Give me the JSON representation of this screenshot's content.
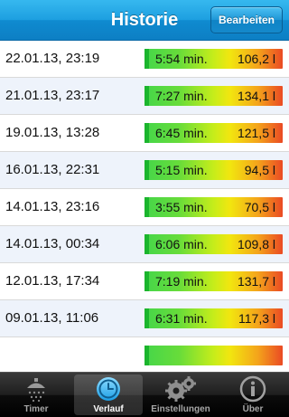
{
  "header": {
    "title": "Historie",
    "edit_label": "Bearbeiten"
  },
  "rows": [
    {
      "date": "22.01.13, 23:19",
      "duration": "5:54 min.",
      "volume": "106,2 l"
    },
    {
      "date": "21.01.13, 23:17",
      "duration": "7:27 min.",
      "volume": "134,1 l"
    },
    {
      "date": "19.01.13, 13:28",
      "duration": "6:45 min.",
      "volume": "121,5 l"
    },
    {
      "date": "16.01.13, 22:31",
      "duration": "5:15 min.",
      "volume": "94,5 l"
    },
    {
      "date": "14.01.13, 23:16",
      "duration": "3:55 min.",
      "volume": "70,5 l"
    },
    {
      "date": "14.01.13, 00:34",
      "duration": "6:06 min.",
      "volume": "109,8 l"
    },
    {
      "date": "12.01.13, 17:34",
      "duration": "7:19 min.",
      "volume": "131,7 l"
    },
    {
      "date": "09.01.13, 11:06",
      "duration": "6:31 min.",
      "volume": "117,3 l"
    },
    {
      "date": "",
      "duration": "",
      "volume": ""
    }
  ],
  "tabs": [
    {
      "label": "Timer",
      "icon": "shower-icon"
    },
    {
      "label": "Verlauf",
      "icon": "clock-icon",
      "active": true
    },
    {
      "label": "Einstellungen",
      "icon": "gears-icon"
    },
    {
      "label": "Über",
      "icon": "info-icon"
    }
  ],
  "colors": {
    "nav": "#1d9fe0",
    "bar_start": "#45d64a",
    "bar_end": "#ea4a24",
    "tabbar": "#1e1e1e"
  }
}
